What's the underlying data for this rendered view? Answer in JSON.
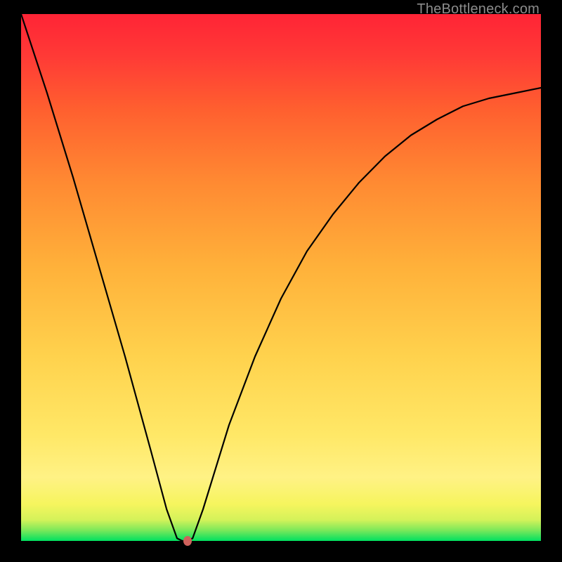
{
  "watermark": "TheBottleneck.com",
  "chart_data": {
    "type": "line",
    "title": "",
    "xlabel": "",
    "ylabel": "",
    "xlim": [
      0,
      100
    ],
    "ylim": [
      0,
      100
    ],
    "series": [
      {
        "name": "curve",
        "x": [
          0,
          5,
          10,
          15,
          20,
          25,
          28,
          30,
          31,
          32,
          33,
          35,
          40,
          45,
          50,
          55,
          60,
          65,
          70,
          75,
          80,
          85,
          90,
          95,
          100
        ],
        "values": [
          100,
          85,
          69,
          52,
          35,
          17,
          6,
          0.5,
          0,
          0,
          0.5,
          6,
          22,
          35,
          46,
          55,
          62,
          68,
          73,
          77,
          80,
          82.5,
          84,
          85,
          86
        ]
      }
    ],
    "marker": {
      "x": 32,
      "y": 0
    },
    "gradient_note": "background encodes value: green=low/good at bottom, red=high/bad at top"
  }
}
